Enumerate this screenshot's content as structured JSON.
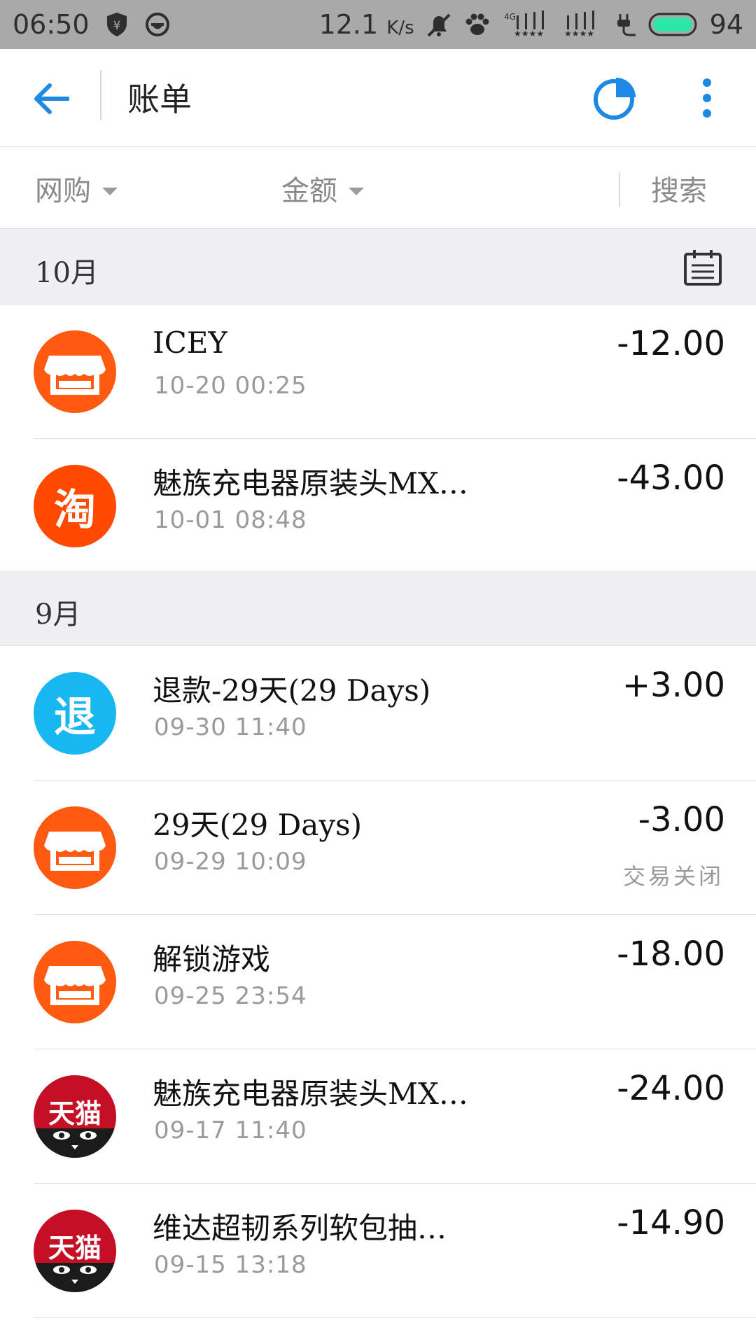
{
  "status_bar": {
    "time": "06:50",
    "speed": "12.1",
    "speed_unit": "K/s",
    "network": "4G",
    "battery": "94"
  },
  "app_bar": {
    "title": "账单"
  },
  "filters": {
    "category": "网购",
    "amount": "金额",
    "search": "搜索"
  },
  "sections": [
    {
      "month": "10月",
      "items": [
        {
          "icon": "shop-icon",
          "name": "ICEY",
          "time": "10-20  00:25",
          "amount": "-12.00",
          "status": ""
        },
        {
          "icon": "taobao-icon",
          "avatar_text": "淘",
          "name": "魅族充电器原装头MX…",
          "time": "10-01  08:48",
          "amount": "-43.00",
          "status": ""
        }
      ]
    },
    {
      "month": "9月",
      "items": [
        {
          "icon": "refund-icon",
          "avatar_text": "退",
          "name": "退款-29天(29 Days)",
          "time": "09-30  11:40",
          "amount": "+3.00",
          "status": ""
        },
        {
          "icon": "shop-icon",
          "name": "29天(29 Days)",
          "time": "09-29  10:09",
          "amount": "-3.00",
          "status": "交易关闭"
        },
        {
          "icon": "shop-icon",
          "name": "解锁游戏",
          "time": "09-25  23:54",
          "amount": "-18.00",
          "status": ""
        },
        {
          "icon": "tmall-icon",
          "avatar_text": "天猫",
          "name": "魅族充电器原装头MX…",
          "time": "09-17  11:40",
          "amount": "-24.00",
          "status": ""
        },
        {
          "icon": "tmall-icon",
          "avatar_text": "天猫",
          "name": "维达超韧系列软包抽…",
          "time": "09-15  13:18",
          "amount": "-14.90",
          "status": ""
        }
      ]
    }
  ],
  "colors": {
    "accent": "#1e88e5",
    "shop_orange": "#ff5a0f",
    "refund_blue": "#19b7ef",
    "tmall_red": "#c40f24",
    "section_bg": "#efeff4"
  }
}
